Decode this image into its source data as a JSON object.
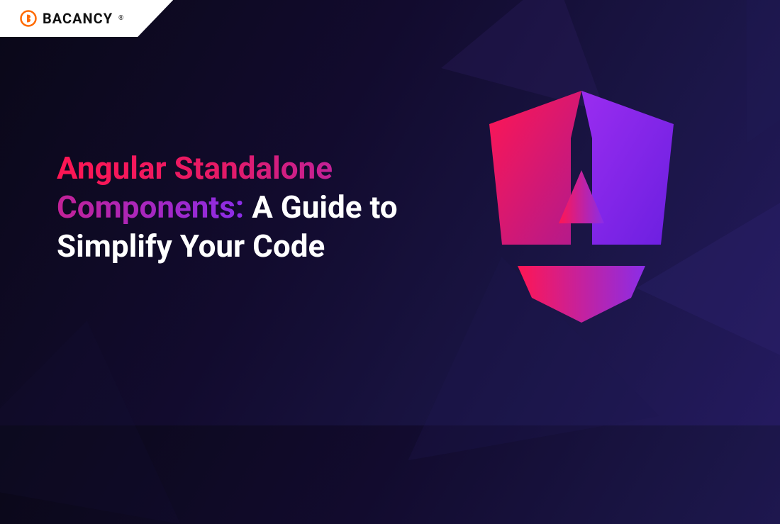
{
  "brand": {
    "name": "BACANCY",
    "mark_alt": "bacancy-logo-mark"
  },
  "hero": {
    "title_highlight": "Angular Standalone Components:",
    "title_rest": " A Guide to Simplify Your Code"
  },
  "colors": {
    "accent_left": "#ff1653",
    "accent_right": "#8a2de8",
    "bg_from": "#0a0818",
    "bg_to": "#241a5f"
  }
}
